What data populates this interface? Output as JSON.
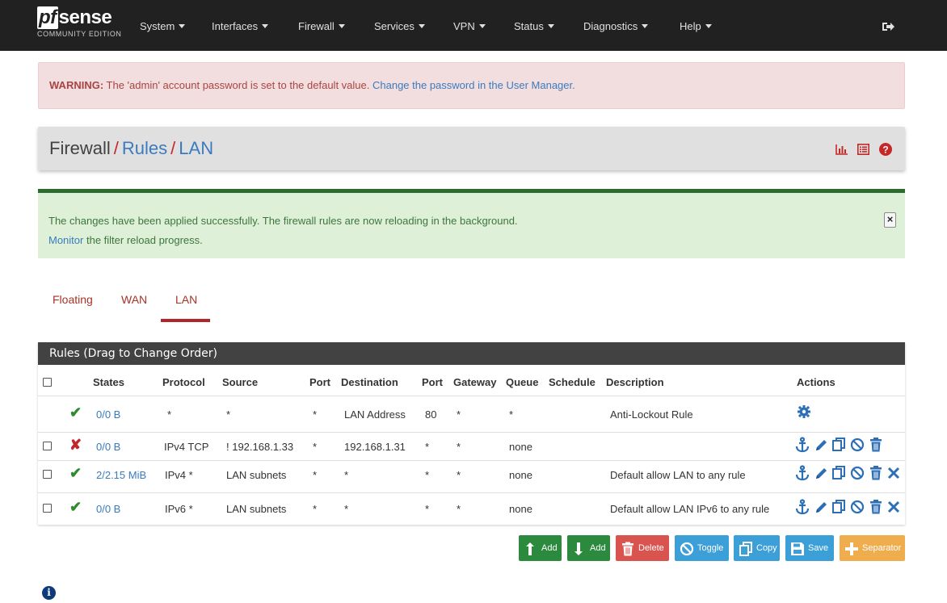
{
  "navbar": {
    "logo_pf": "pf",
    "logo_sense": "sense",
    "logo_edition": "COMMUNITY EDITION",
    "menus": [
      "System",
      "Interfaces",
      "Firewall",
      "Services",
      "VPN",
      "Status",
      "Diagnostics",
      "Help"
    ],
    "logout_icon": "sign-out-icon",
    "color": "#212121"
  },
  "warning": {
    "bold": "WARNING:",
    "text": " The 'admin' account password is set to the default value. ",
    "link": "Change the password in the User Manager."
  },
  "breadcrumb": {
    "first": "Firewall",
    "sep1": "/",
    "second": "Rules",
    "sep2": "/",
    "third": "LAN",
    "icons": [
      "bar-chart-icon",
      "list-icon",
      "help-icon"
    ]
  },
  "success": {
    "line1": "The changes have been applied successfully. The firewall rules are now reloading in the background.",
    "link": "Monitor",
    "line2_rest": " the filter reload progress.",
    "close": "×"
  },
  "tabs": [
    {
      "label": "Floating",
      "active": false
    },
    {
      "label": "WAN",
      "active": false
    },
    {
      "label": "LAN",
      "active": true
    }
  ],
  "rules": {
    "heading": "Rules (Drag to Change Order)",
    "columns": [
      "States",
      "Protocol",
      "Source",
      "Port",
      "Destination",
      "Port",
      "Gateway",
      "Queue",
      "Schedule",
      "Description",
      "Actions"
    ],
    "rows": [
      {
        "status": "enabled",
        "states": "0/0 B",
        "protocol": "*",
        "source": "*",
        "sport": "*",
        "destination": "LAN Address",
        "dport": "80",
        "gateway": "*",
        "queue": "*",
        "schedule": "",
        "description": "Anti-Lockout Rule",
        "actions": [
          "gear-icon"
        ]
      },
      {
        "status": "blocked",
        "states": "0/0 B",
        "protocol": "IPv4 TCP",
        "source": "! 192.168.1.33",
        "sport": "*",
        "destination": "192.168.1.31",
        "dport": "*",
        "gateway": "*",
        "queue": "none",
        "schedule": "",
        "description": "",
        "actions": [
          "anchor-icon",
          "pencil-icon",
          "copy-icon",
          "ban-icon",
          "trash-icon"
        ]
      },
      {
        "status": "enabled",
        "states": "2/2.15 MiB",
        "protocol": "IPv4 *",
        "source": "LAN subnets",
        "sport": "*",
        "destination": "*",
        "dport": "*",
        "gateway": "*",
        "queue": "none",
        "schedule": "",
        "description": "Default allow LAN to any rule",
        "actions": [
          "anchor-icon",
          "pencil-icon",
          "copy-icon",
          "ban-icon",
          "trash-icon",
          "times-icon"
        ]
      },
      {
        "status": "enabled",
        "states": "0/0 B",
        "protocol": "IPv6 *",
        "source": "LAN subnets",
        "sport": "*",
        "destination": "*",
        "dport": "*",
        "gateway": "*",
        "queue": "none",
        "schedule": "",
        "description": "Default allow LAN IPv6 to any rule",
        "actions": [
          "anchor-icon",
          "pencil-icon",
          "copy-icon",
          "ban-icon",
          "trash-icon",
          "times-icon"
        ]
      }
    ]
  },
  "buttons": [
    {
      "label": "Add",
      "icon": "arrow-up-icon",
      "color": "#2b8a3e"
    },
    {
      "label": "Add",
      "icon": "arrow-down-icon",
      "color": "#2b8a3e"
    },
    {
      "label": "Delete",
      "icon": "trash-icon",
      "color": "#d9534f"
    },
    {
      "label": "Toggle",
      "icon": "ban-icon",
      "color": "#3d9fd8"
    },
    {
      "label": "Copy",
      "icon": "copy-icon",
      "color": "#3d9fd8"
    },
    {
      "label": "Save",
      "icon": "save-icon",
      "color": "#3d9fd8"
    },
    {
      "label": "Separator",
      "icon": "plus-icon",
      "color": "#f0ad4e"
    }
  ],
  "footer_icon": "info-icon"
}
